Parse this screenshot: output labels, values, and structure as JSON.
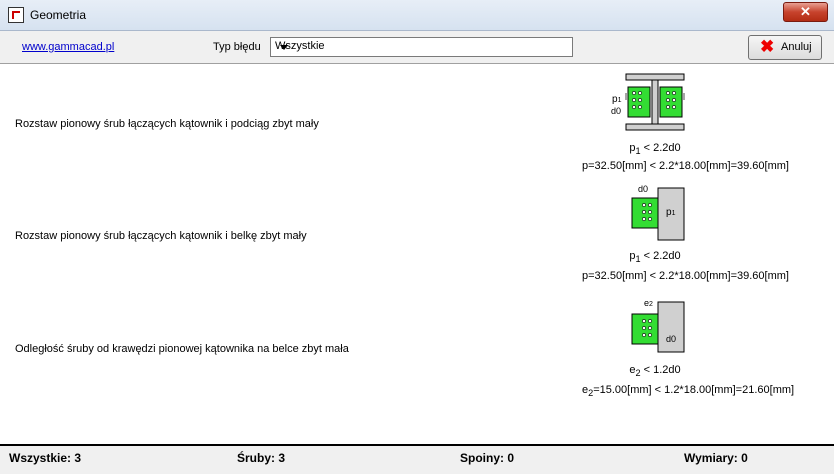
{
  "window": {
    "title": "Geometria",
    "close_label": "✕"
  },
  "toolbar": {
    "link": "www.gammacad.pl",
    "type_label": "Typ błędu",
    "type_value": "Wszystkie",
    "cancel_label": "Anuluj"
  },
  "rows": [
    {
      "message": "Rozstaw pionowy śrub łączących kątownik i podciąg zbyt mały",
      "fig_labels": {
        "p": "p",
        "p_sub": "1",
        "d": "d0"
      },
      "cond": {
        "symbol": "p",
        "sub": "1",
        "rel": "< 2.2d0"
      },
      "result": "p=32.50[mm]  <  2.2*18.00[mm]=39.60[mm]"
    },
    {
      "message": "Rozstaw pionowy śrub łączących kątownik i belkę zbyt mały",
      "fig_labels": {
        "p": "p",
        "p_sub": "1",
        "d": "d0"
      },
      "cond": {
        "symbol": "p",
        "sub": "1",
        "rel": "< 2.2d0"
      },
      "result": "p=32.50[mm]  <  2.2*18.00[mm]=39.60[mm]"
    },
    {
      "message": "Odległość śruby od krawędzi pionowej kątownika na belce zbyt mała",
      "fig_labels": {
        "e": "e",
        "e_sub": "2",
        "d": "d0"
      },
      "cond": {
        "symbol": "e",
        "sub": "2",
        "rel": "< 1.2d0"
      },
      "result_sym": "e",
      "result_sub": "2",
      "result": "=15.00[mm]  <  1.2*18.00[mm]=21.60[mm]"
    }
  ],
  "status": {
    "all": "Wszystkie: 3",
    "bolts": "Śruby: 3",
    "welds": "Spoiny: 0",
    "dims": "Wymiary: 0"
  },
  "colors": {
    "plate": "#33dd33",
    "beam": "#d0d0d0"
  }
}
